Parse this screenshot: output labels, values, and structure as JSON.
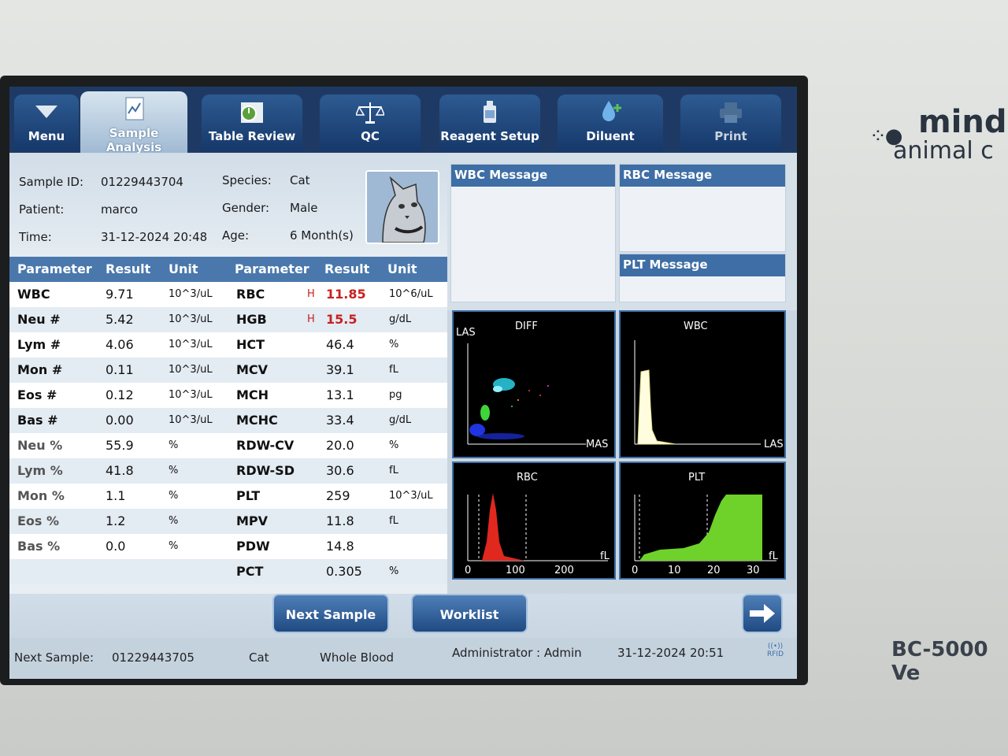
{
  "device": {
    "brand_line1": "mind",
    "brand_line2": "animal c",
    "model": "BC-5000 Ve"
  },
  "tabs": [
    {
      "label": "Menu",
      "icon": "menu-down-icon",
      "state": "normal"
    },
    {
      "label": "Sample Analysis",
      "icon": "chart-document-icon",
      "state": "active"
    },
    {
      "label": "Table Review",
      "icon": "table-review-icon",
      "state": "normal"
    },
    {
      "label": "QC",
      "icon": "scale-icon",
      "state": "normal"
    },
    {
      "label": "Reagent Setup",
      "icon": "reagent-bottle-icon",
      "state": "normal"
    },
    {
      "label": "Diluent",
      "icon": "drop-plus-icon",
      "state": "normal"
    },
    {
      "label": "Print",
      "icon": "printer-icon",
      "state": "disabled"
    }
  ],
  "sample": {
    "id_label": "Sample ID:",
    "id_value": "01229443704",
    "patient_label": "Patient:",
    "patient_value": "marco",
    "time_label": "Time:",
    "time_value": "31-12-2024 20:48",
    "species_label": "Species:",
    "species_value": "Cat",
    "gender_label": "Gender:",
    "gender_value": "Male",
    "age_label": "Age:",
    "age_value": "6 Month(s)"
  },
  "table": {
    "headers": [
      "Parameter",
      "Result",
      "Unit",
      "Parameter",
      "Result",
      "Unit"
    ],
    "left": [
      {
        "param": "WBC",
        "result": "9.71",
        "unit": "10^3/uL"
      },
      {
        "param": "Neu #",
        "result": "5.42",
        "unit": "10^3/uL"
      },
      {
        "param": "Lym #",
        "result": "4.06",
        "unit": "10^3/uL"
      },
      {
        "param": "Mon #",
        "result": "0.11",
        "unit": "10^3/uL"
      },
      {
        "param": "Eos #",
        "result": "0.12",
        "unit": "10^3/uL"
      },
      {
        "param": "Bas #",
        "result": "0.00",
        "unit": "10^3/uL"
      },
      {
        "param": "Neu %",
        "result": "55.9",
        "unit": "%"
      },
      {
        "param": "Lym %",
        "result": "41.8",
        "unit": "%"
      },
      {
        "param": "Mon %",
        "result": "1.1",
        "unit": "%"
      },
      {
        "param": "Eos %",
        "result": "1.2",
        "unit": "%"
      },
      {
        "param": "Bas %",
        "result": "0.0",
        "unit": "%"
      }
    ],
    "right": [
      {
        "param": "RBC",
        "flag": "H",
        "result": "11.85",
        "unit": "10^6/uL"
      },
      {
        "param": "HGB",
        "flag": "H",
        "result": "15.5",
        "unit": "g/dL"
      },
      {
        "param": "HCT",
        "flag": "",
        "result": "46.4",
        "unit": "%"
      },
      {
        "param": "MCV",
        "flag": "",
        "result": "39.1",
        "unit": "fL"
      },
      {
        "param": "MCH",
        "flag": "",
        "result": "13.1",
        "unit": "pg"
      },
      {
        "param": "MCHC",
        "flag": "",
        "result": "33.4",
        "unit": "g/dL"
      },
      {
        "param": "RDW-CV",
        "flag": "",
        "result": "20.0",
        "unit": "%"
      },
      {
        "param": "RDW-SD",
        "flag": "",
        "result": "30.6",
        "unit": "fL"
      },
      {
        "param": "PLT",
        "flag": "",
        "result": "259",
        "unit": "10^3/uL"
      },
      {
        "param": "MPV",
        "flag": "",
        "result": "11.8",
        "unit": "fL"
      },
      {
        "param": "PDW",
        "flag": "",
        "result": "14.8",
        "unit": ""
      },
      {
        "param": "PCT",
        "flag": "",
        "result": "0.305",
        "unit": "%"
      }
    ]
  },
  "messages": {
    "wbc": "WBC Message",
    "rbc": "RBC Message",
    "plt": "PLT Message"
  },
  "graphs": {
    "diff": {
      "title": "DIFF",
      "y_label": "LAS",
      "x_label": "MAS"
    },
    "wbc": {
      "title": "WBC",
      "x_label": "LAS"
    },
    "rbc": {
      "title": "RBC",
      "unit": "fL",
      "ticks": [
        "0",
        "100",
        "200"
      ]
    },
    "plt": {
      "title": "PLT",
      "unit": "fL",
      "ticks": [
        "0",
        "10",
        "20",
        "30"
      ]
    }
  },
  "buttons": {
    "next_sample": "Next Sample",
    "worklist": "Worklist",
    "arrow": "right-arrow-icon"
  },
  "status": {
    "next_label": "Next Sample:",
    "next_id": "01229443705",
    "next_species": "Cat",
    "next_mode": "Whole Blood",
    "user": "Administrator : Admin",
    "datetime": "31-12-2024 20:51",
    "rfid": "RFID"
  },
  "colors": {
    "tab_bar": "#1e3a64",
    "header_blue": "#4a78ad",
    "high_flag": "#c82020",
    "rbc_curve": "#e0281e",
    "plt_curve": "#6ed22a"
  }
}
